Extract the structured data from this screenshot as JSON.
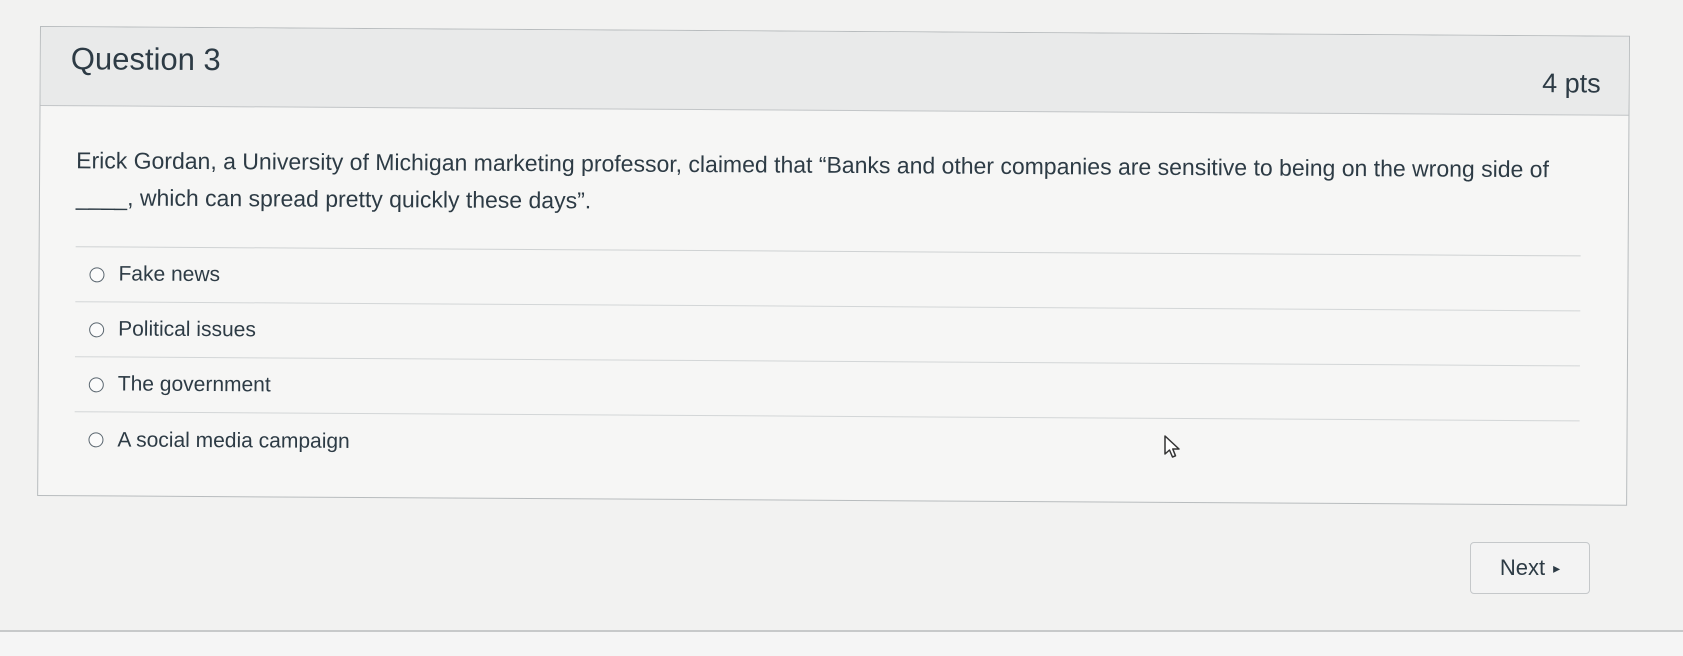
{
  "question": {
    "title": "Question 3",
    "points": "4 pts",
    "text": "Erick Gordan, a University of Michigan marketing professor, claimed that “Banks and other companies are sensitive to being on the wrong side of ____, which can spread pretty quickly these days”.",
    "answers": [
      {
        "label": "Fake news",
        "selected": false
      },
      {
        "label": "Political issues",
        "selected": false
      },
      {
        "label": "The government",
        "selected": false
      },
      {
        "label": "A social media campaign",
        "selected": false
      }
    ]
  },
  "navigation": {
    "next_label": "Next",
    "next_icon": "triangle-right-icon"
  },
  "cursor": {
    "icon": "mouse-pointer-icon"
  },
  "colors": {
    "text": "#2d3b45",
    "card_background": "#f6f6f5",
    "header_background": "#e9eaea",
    "border": "#b8bcbe"
  }
}
